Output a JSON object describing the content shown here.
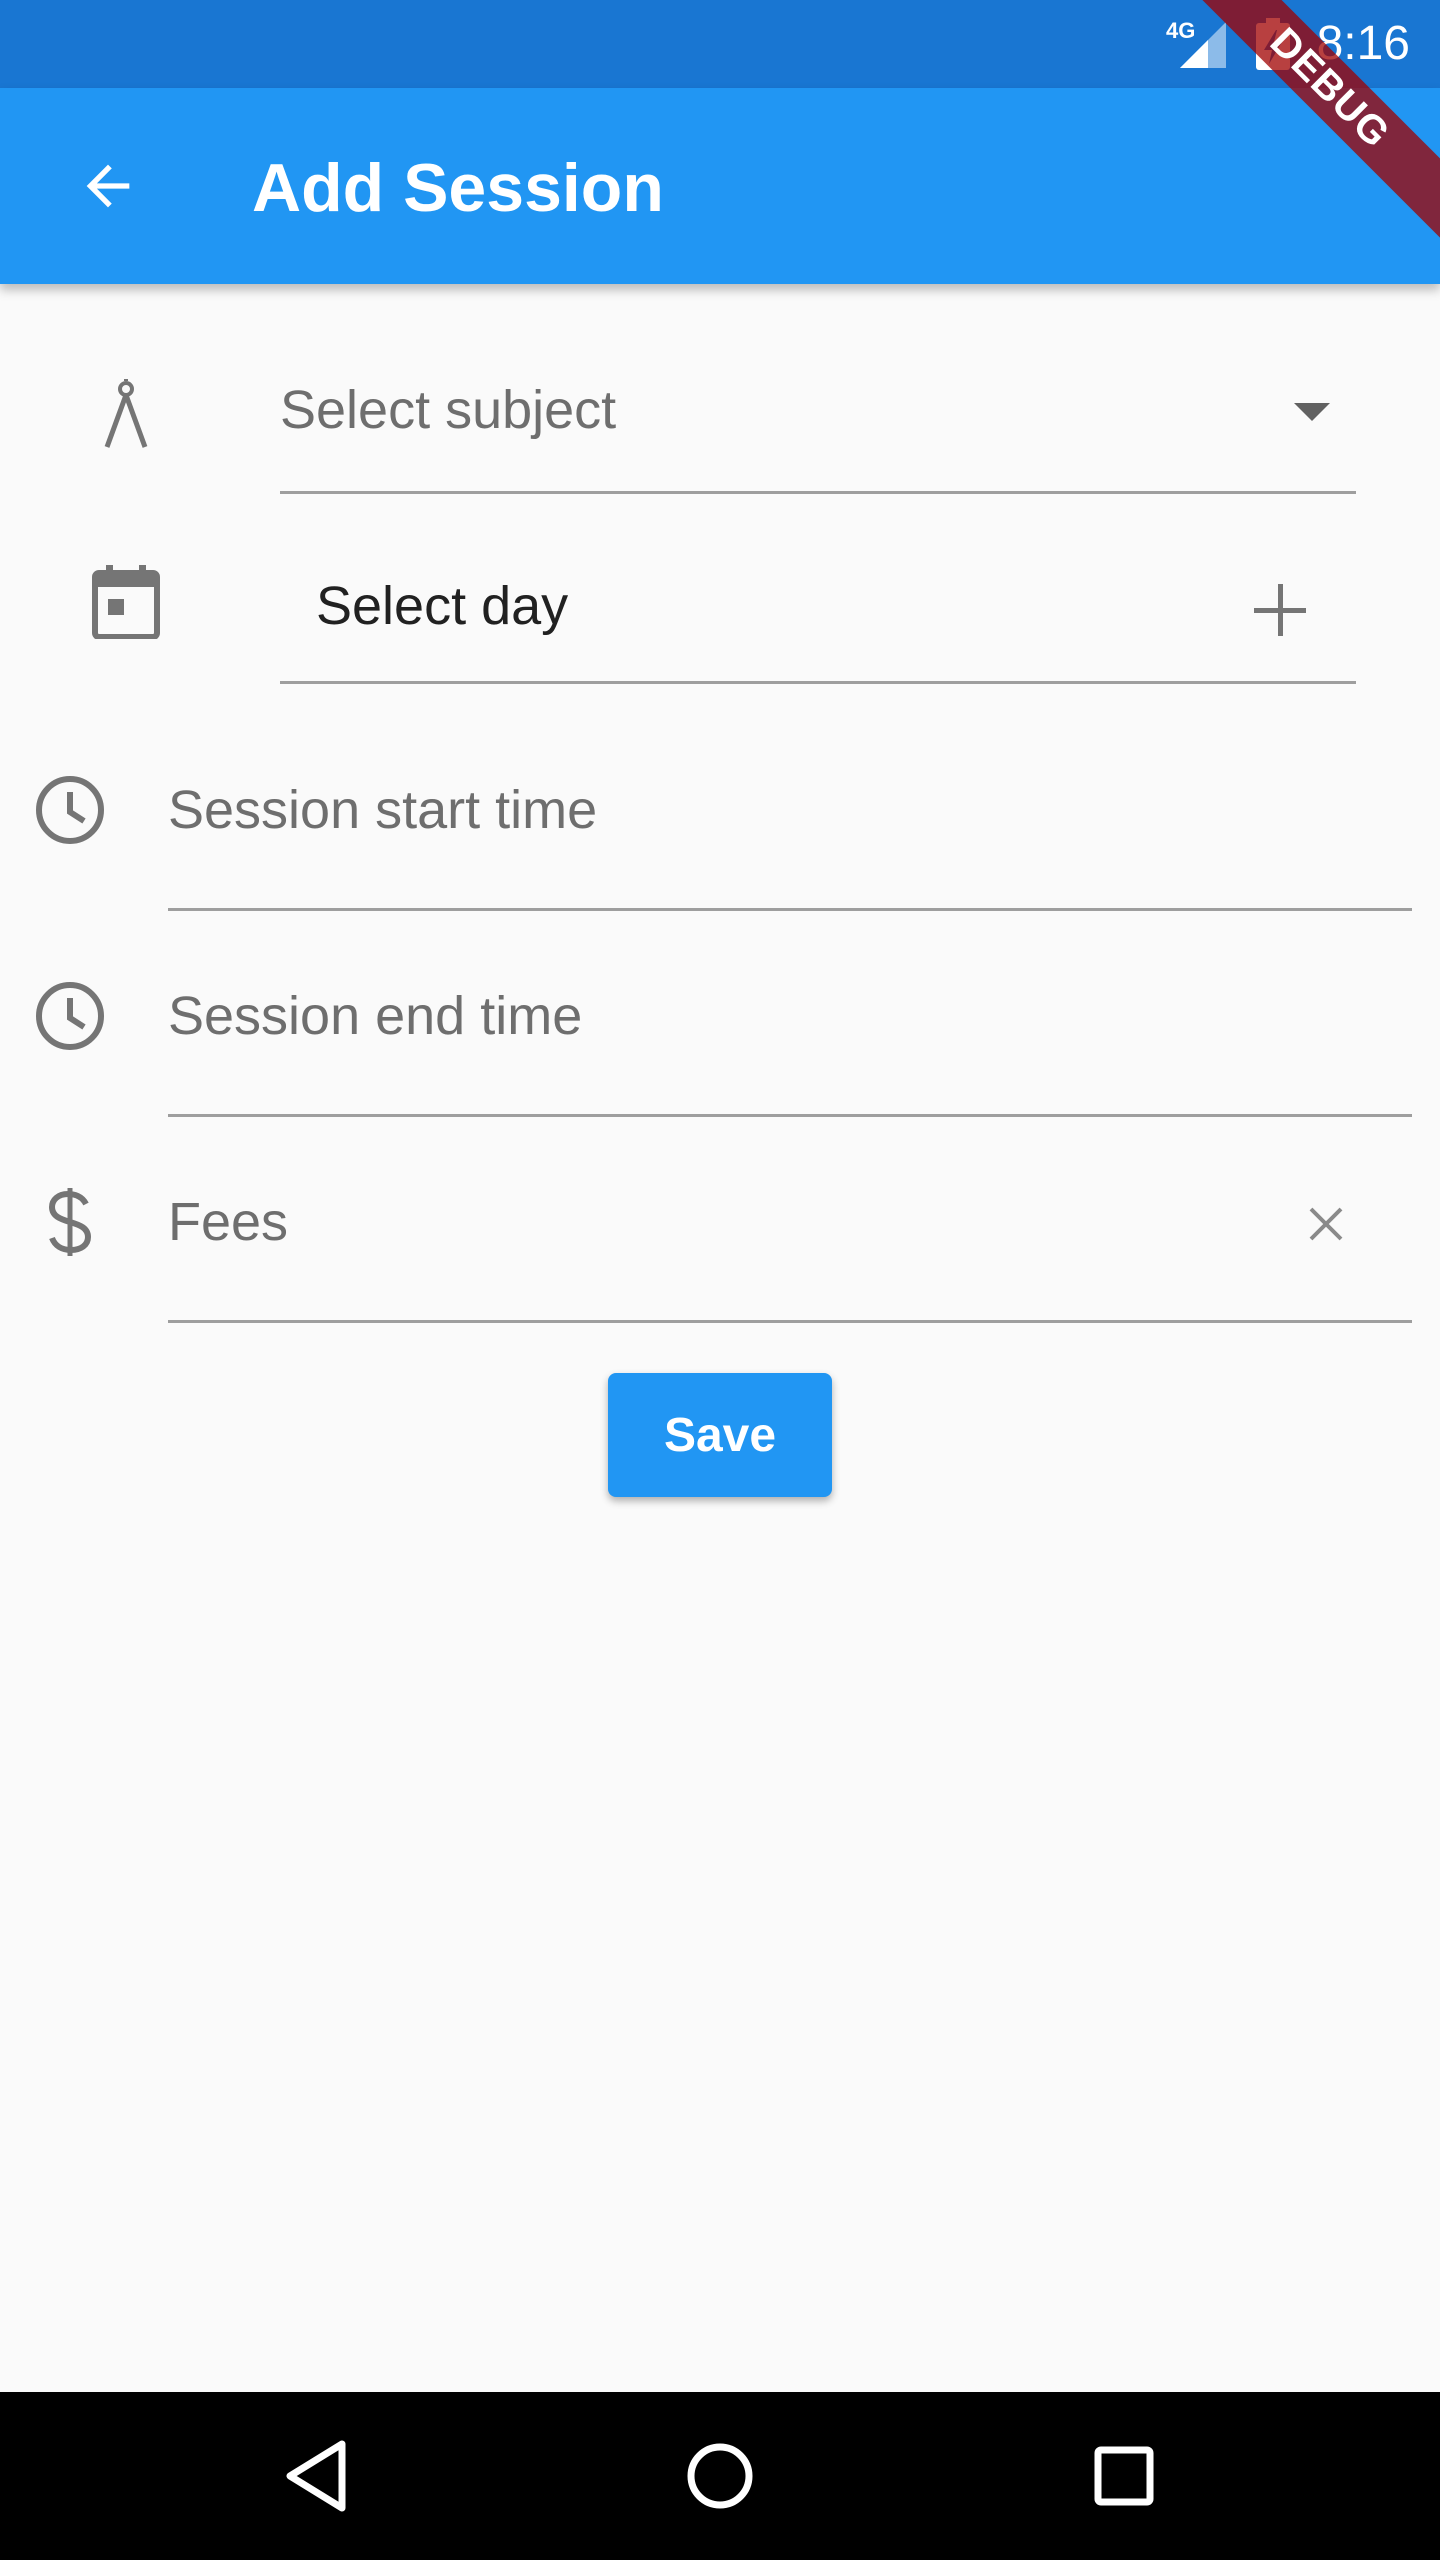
{
  "status_bar": {
    "time": "8:16",
    "network": "4G",
    "icons": [
      "network-4g-icon",
      "signal-icon",
      "battery-charging-icon"
    ]
  },
  "debug_banner": "DEBUG",
  "app_bar": {
    "title": "Add Session",
    "back_icon": "arrow-back-icon",
    "color": "#2196F3"
  },
  "form": {
    "subject": {
      "placeholder": "Select subject",
      "icon": "compass-icon",
      "trailing_icon": "dropdown-arrow-icon"
    },
    "day": {
      "label": "Select day",
      "icon": "calendar-icon",
      "trailing_icon": "plus-icon"
    },
    "start_time": {
      "placeholder": "Session start time",
      "icon": "clock-icon"
    },
    "end_time": {
      "placeholder": "Session end time",
      "icon": "clock-icon"
    },
    "fees": {
      "placeholder": "Fees",
      "icon": "dollar-icon",
      "trailing_icon": "clear-icon"
    },
    "save_label": "Save"
  },
  "nav_bar": {
    "icons": [
      "back-triangle-icon",
      "home-circle-icon",
      "recents-square-icon"
    ]
  }
}
